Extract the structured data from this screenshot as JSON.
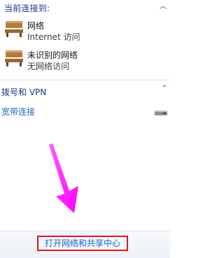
{
  "header": {
    "title": "当前连接到:",
    "chevron_icon": "chevron-up-icon"
  },
  "networks": [
    {
      "name": "网络",
      "status": "Internet 访问",
      "icon": "bench-network-icon"
    },
    {
      "name": "未识别的网络",
      "status": "无网络访问",
      "icon": "bench-network-icon"
    }
  ],
  "dialup": {
    "section_title": "拨号和 VPN",
    "chevron_icon": "chevron-up-icon",
    "connection_label": "宽带连接",
    "connection_icon": "modem-icon"
  },
  "footer": {
    "open_center_label": "打开网络和共享中心"
  },
  "annotation": {
    "arrow_icon": "pointer-arrow-icon",
    "arrow_color": "#ff22ff",
    "highlight_color": "#e0161d"
  }
}
